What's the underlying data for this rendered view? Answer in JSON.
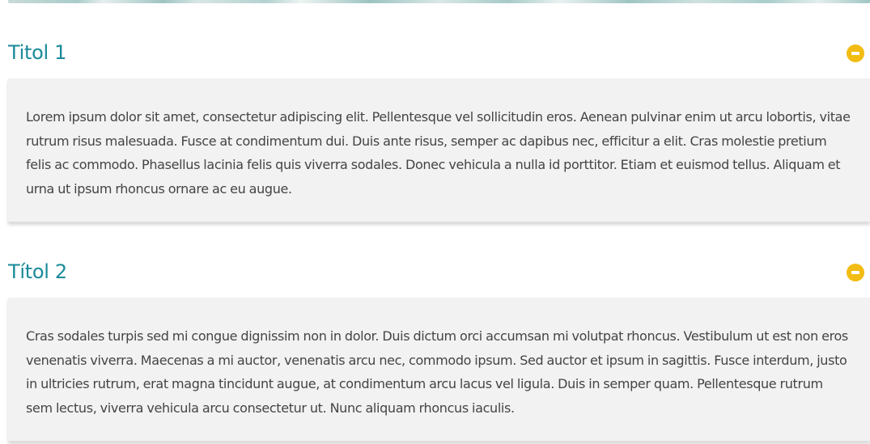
{
  "sections": [
    {
      "title": "Titol 1",
      "expanded": true,
      "toggle_icon": "minus-circle-icon",
      "body": "Lorem ipsum dolor sit amet, consectetur adipiscing elit. Pellentesque vel sollicitudin eros. Aenean pulvinar enim ut arcu lobortis, vitae rutrum risus malesuada. Fusce at condimentum dui. Duis ante risus, semper ac dapibus nec, efficitur a elit. Cras molestie pretium felis ac commodo. Phasellus lacinia felis quis viverra sodales. Donec vehicula a nulla id porttitor. Etiam et euismod tellus. Aliquam et urna ut ipsum rhoncus ornare ac eu augue."
    },
    {
      "title": "Títol 2",
      "expanded": true,
      "toggle_icon": "minus-circle-icon",
      "body": "Cras sodales turpis sed mi congue dignissim non in dolor. Duis dictum orci accumsan mi volutpat rhoncus. Vestibulum ut est non eros venenatis viverra. Maecenas a mi auctor, venenatis arcu nec, commodo ipsum. Sed auctor et ipsum in sagittis. Fusce interdum, justo in ultricies rutrum, erat magna tincidunt augue, at condimentum arcu lacus vel ligula. Duis in semper quam. Pellentesque rutrum sem lectus, viverra vehicula arcu consectetur ut. Nunc aliquam rhoncus iaculis."
    }
  ],
  "colors": {
    "title": "#1a8a99",
    "toggle_icon": "#f2bc12",
    "panel_background": "#f2f2f2",
    "body_text": "#444444"
  }
}
